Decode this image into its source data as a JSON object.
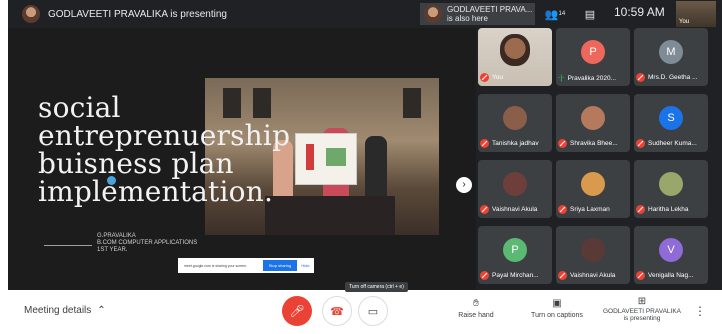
{
  "topbar": {
    "presenter_text": "GODLAVEETI PRAVALIKA is presenting",
    "also_here_line1": "GODLAVEETI PRAVA...",
    "also_here_line2": "is also here",
    "people_count": "14",
    "time": "10:59 AM",
    "self_label": "You"
  },
  "slide": {
    "title_lines": [
      "social",
      "entreprenuership",
      "buisness plan",
      "implementation."
    ],
    "author_lines": [
      "G.PRAVALIKA",
      "B.COM COMPUTER APPLICATIONS",
      "1ST YEAR."
    ],
    "share_text": "meet.google.com is sharing your screen.",
    "stop_label": "Stop sharing",
    "hide_label": "Hide",
    "next_icon": "chevron-right-icon"
  },
  "participants": [
    {
      "name": "You",
      "kind": "video"
    },
    {
      "name": "Pravalika 2020...",
      "kind": "letter",
      "letter": "P",
      "color": "#ee675c",
      "mic": "on"
    },
    {
      "name": "Mrs.D. Geetha ...",
      "kind": "letter",
      "letter": "M",
      "color": "#7f8c95",
      "mic": "off"
    },
    {
      "name": "Tanishka jadhav",
      "kind": "photo",
      "color": "#8b5e4a",
      "mic": "off"
    },
    {
      "name": "Shravika Bhee...",
      "kind": "photo",
      "color": "#b57a5e",
      "mic": "off"
    },
    {
      "name": "Sudheer Kuma...",
      "kind": "letter",
      "letter": "S",
      "color": "#1a73e8",
      "mic": "off"
    },
    {
      "name": "Vaishnavi Akula",
      "kind": "photo",
      "color": "#6e3f3a",
      "mic": "off"
    },
    {
      "name": "Sriya Laxman",
      "kind": "photo",
      "color": "#d99a4e",
      "mic": "off"
    },
    {
      "name": "Haritha Lekha",
      "kind": "photo",
      "color": "#9aa76a",
      "mic": "off"
    },
    {
      "name": "Payal Mirchan...",
      "kind": "letter",
      "letter": "P",
      "color": "#5bb974",
      "mic": "off"
    },
    {
      "name": "Vaishnavi Akula",
      "kind": "photo",
      "color": "#5a3a36",
      "mic": "off"
    },
    {
      "name": "Venigalla Nag...",
      "kind": "letter",
      "letter": "V",
      "color": "#8f6bd8",
      "mic": "off"
    }
  ],
  "bottombar": {
    "meeting_details": "Meeting details",
    "camera_tooltip": "Turn off camera (ctrl + e)",
    "raise_hand": "Raise hand",
    "captions": "Turn on captions",
    "presenting_line1": "GODLAVEETI PRAVALIKA",
    "presenting_line2": "is presenting"
  },
  "colors": {
    "background": "#202124",
    "tile": "#3c4043",
    "danger": "#ea4335",
    "accent": "#1a73e8"
  }
}
